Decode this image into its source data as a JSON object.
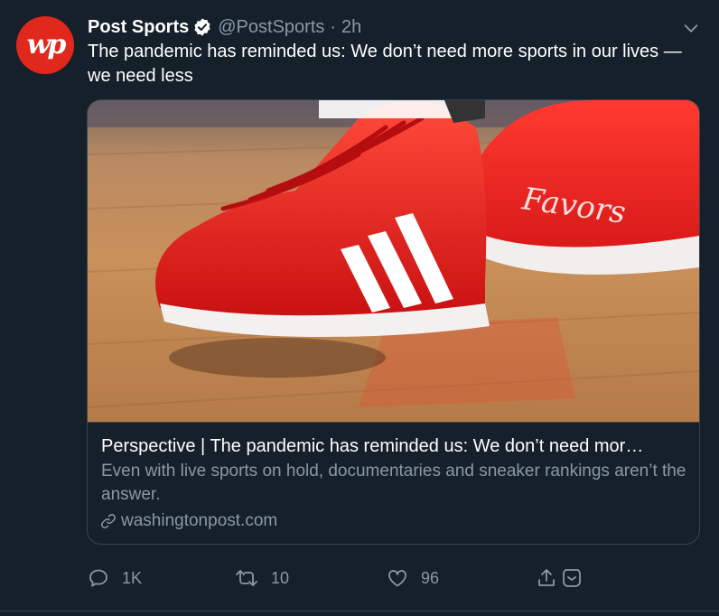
{
  "tweet": {
    "display_name": "Post Sports",
    "handle": "@PostSports",
    "separator": "·",
    "time": "2h",
    "text": "The pandemic has reminded us: We don’t need more sports in our lives — we need less",
    "avatar": {
      "logo": "wp",
      "color": "#e0281c"
    }
  },
  "card": {
    "title": "Perspective | The pandemic has reminded us: We don’t need mor…",
    "description": "Even with live sports on hold, documentaries and sneaker rankings aren’t the answer.",
    "domain": "washingtonpost.com",
    "image": {
      "shoe_text": "Favors",
      "shoe_color": "#e01e1e",
      "floor_color": "#c9905a"
    }
  },
  "actions": {
    "reply_count": "1K",
    "retweet_count": "10",
    "like_count": "96"
  },
  "colors": {
    "background": "#15202b",
    "secondary_text": "#8899a6",
    "border": "#38444d"
  },
  "icons": [
    "verified-icon",
    "chevron-down-icon",
    "link-icon",
    "reply-icon",
    "retweet-icon",
    "like-icon",
    "share-icon",
    "save-icon"
  ]
}
